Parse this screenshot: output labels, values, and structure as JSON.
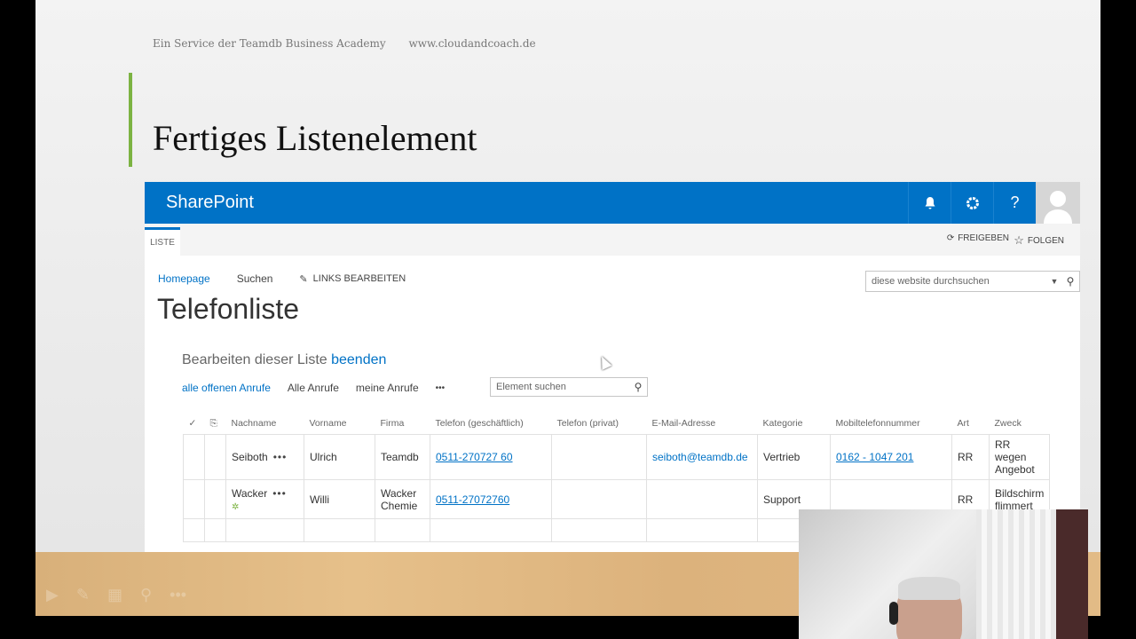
{
  "slide": {
    "header_left": "Ein Service der Teamdb Business Academy",
    "header_right": "www.cloudandcoach.de",
    "title": "Fertiges Listenelement"
  },
  "suitebar": {
    "brand": "SharePoint",
    "icons": [
      "bell-icon",
      "gear-icon",
      "help-icon",
      "avatar"
    ],
    "help_label": "?"
  },
  "ribbon": {
    "tab": "LISTE",
    "share": "FREIGEBEN",
    "follow": "FOLGEN"
  },
  "nav": {
    "home": "Homepage",
    "search": "Suchen",
    "edit_links": "LINKS BEARBEITEN"
  },
  "site_search": {
    "placeholder": "diese website durchsuchen"
  },
  "page_title": "Telefonliste",
  "edit_bar": {
    "text": "Bearbeiten dieser Liste",
    "link": "beenden"
  },
  "views": {
    "items": [
      "alle offenen Anrufe",
      "Alle Anrufe",
      "meine Anrufe"
    ],
    "more": "•••"
  },
  "element_search": {
    "placeholder": "Element suchen"
  },
  "table": {
    "headers": [
      "Nachname",
      "Vorname",
      "Firma",
      "Telefon (geschäftlich)",
      "Telefon (privat)",
      "E-Mail-Adresse",
      "Kategorie",
      "Mobiltelefonnummer",
      "Art",
      "Zweck"
    ],
    "rows": [
      {
        "nachname": "Seiboth",
        "vorname": "Ulrich",
        "firma": "Teamdb",
        "telefon": "0511-270727 60",
        "privat": "",
        "email": "seiboth@teamdb.de",
        "kategorie": "Vertrieb",
        "mobil": "0162 - 1047 201",
        "art": "RR",
        "zweck": "RR wegen Angebot"
      },
      {
        "nachname": "Wacker",
        "vorname": "Willi",
        "firma": "Wacker Chemie",
        "telefon": "0511-27072760",
        "privat": "",
        "email": "",
        "kategorie": "Support",
        "mobil": "",
        "art": "RR",
        "zweck": "Bildschirm flimmert"
      }
    ]
  }
}
